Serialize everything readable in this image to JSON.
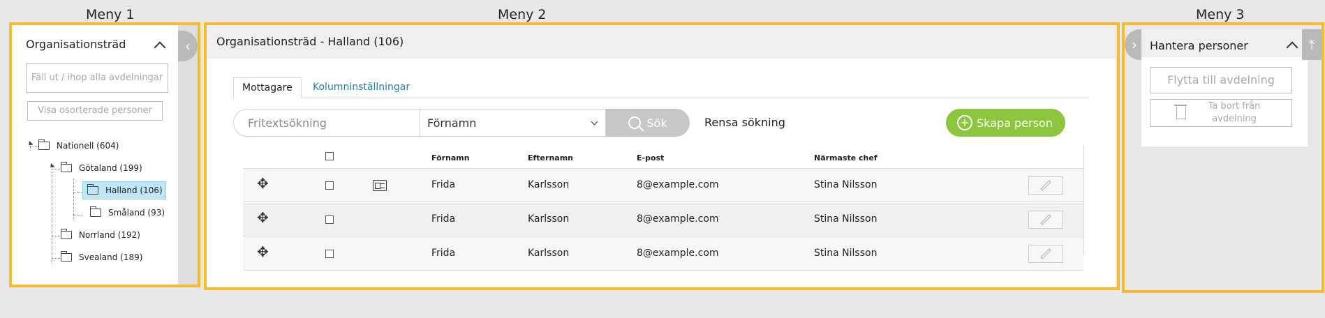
{
  "labels": {
    "meny1": "Meny 1",
    "meny2": "Meny 2",
    "meny3": "Meny 3"
  },
  "menu1": {
    "title": "Organisationsträd",
    "expand_all": "Fäll ut / ihop alla avdelningar",
    "show_unsorted": "Visa osorterade personer",
    "tree": [
      {
        "label": "Nationell (604)"
      },
      {
        "label": "Götaland (199)"
      },
      {
        "label": "Halland (106)"
      },
      {
        "label": "Småland (93)"
      },
      {
        "label": "Norrland (192)"
      },
      {
        "label": "Svealand (189)"
      }
    ]
  },
  "menu2": {
    "title": "Organisationsträd - Halland (106)",
    "tabs": [
      {
        "label": "Mottagare"
      },
      {
        "label": "Kolumninställningar"
      }
    ],
    "search": {
      "placeholder": "Fritextsökning",
      "field": "Förnamn",
      "button": "Sök"
    },
    "clear": "Rensa sökning",
    "create": "Skapa person",
    "columns": {
      "first": "Förnamn",
      "last": "Efternamn",
      "email": "E-post",
      "manager": "Närmaste chef"
    },
    "rows": [
      {
        "first": "Frida",
        "last": "Karlsson",
        "email": "8@example.com",
        "manager": "Stina Nilsson"
      },
      {
        "first": "Frida",
        "last": "Karlsson",
        "email": "8@example.com",
        "manager": "Stina Nilsson"
      },
      {
        "first": "Frida",
        "last": "Karlsson",
        "email": "8@example.com",
        "manager": "Stina Nilsson"
      }
    ]
  },
  "menu3": {
    "title": "Hantera personer",
    "move": "Flytta till avdelning",
    "remove": "Ta bort från avdelning"
  },
  "colors": {
    "accent": "#f3bd2e",
    "create": "#8cc63f",
    "link": "#2a7fa0",
    "selected": "#bfe6f7"
  }
}
